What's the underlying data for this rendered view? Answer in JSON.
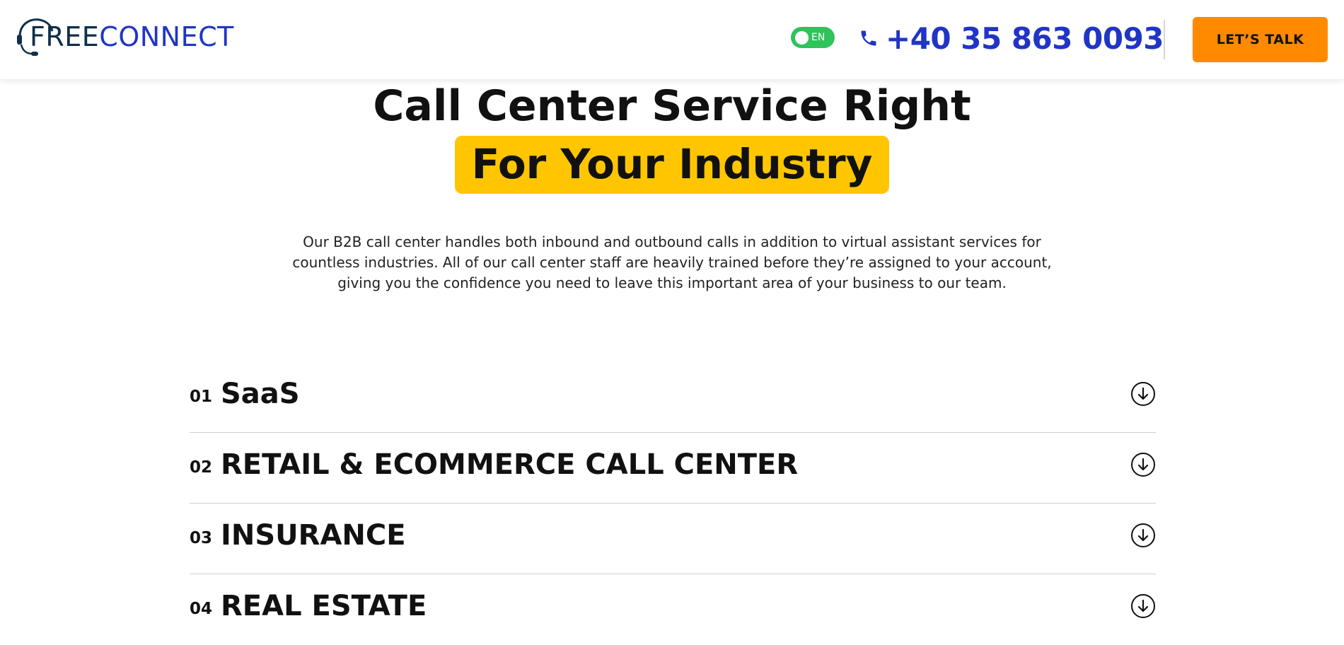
{
  "header": {
    "logo": {
      "part1": "FREE",
      "part2": "CONNECT"
    },
    "language": "EN",
    "phone": "+40 35 863 0093",
    "cta_label": "LET’S TALK",
    "icons": {
      "logo": "headset-icon",
      "phone": "phone-icon"
    }
  },
  "hero": {
    "title_line1": "Call Center Service Right",
    "title_highlight": "For Your Industry",
    "description": "Our B2B call center handles both inbound and outbound calls in addition to virtual assistant services for countless industries. All of our call center staff are heavily trained before they’re assigned to your account, giving you the confidence you need to leave this important area of your business to our team."
  },
  "industries": [
    {
      "num": "01",
      "title": "SaaS"
    },
    {
      "num": "02",
      "title": "RETAIL & ECOMMERCE CALL CENTER"
    },
    {
      "num": "03",
      "title": "INSURANCE"
    },
    {
      "num": "04",
      "title": "REAL ESTATE"
    }
  ],
  "colors": {
    "brand_blue": "#2035c6",
    "brand_dark": "#0f2f4a",
    "cta_orange": "#ff8a00",
    "highlight_yellow": "#ffc600",
    "toggle_green": "#2fc35a"
  }
}
